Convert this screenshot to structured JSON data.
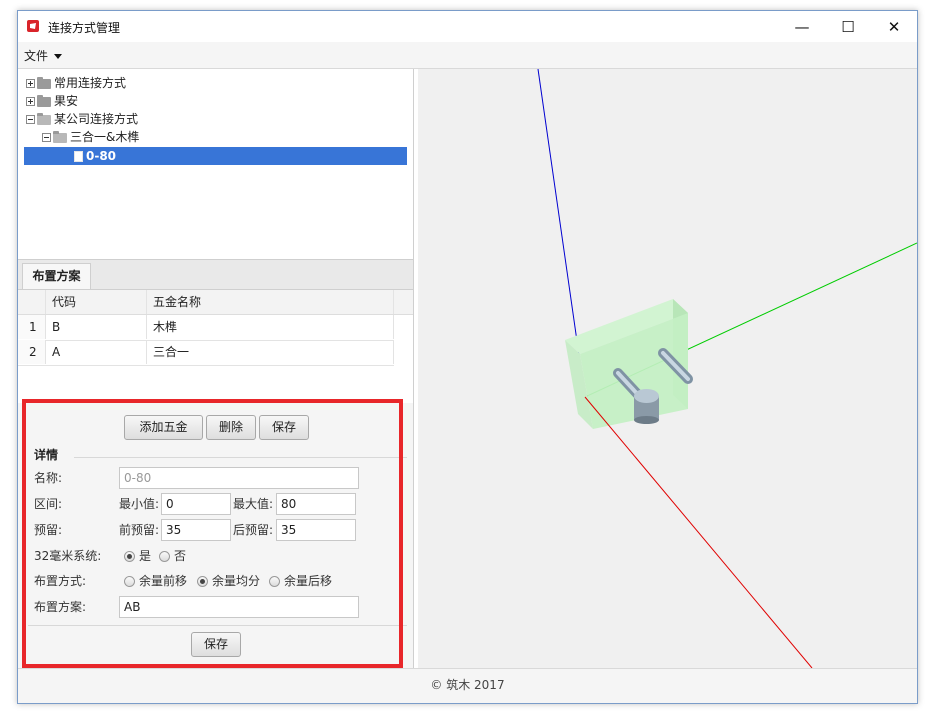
{
  "window": {
    "title": "连接方式管理",
    "controls": {
      "minimize": "—",
      "maximize": "☐",
      "close": "✕"
    }
  },
  "menu": {
    "file_label": "文件"
  },
  "tree": {
    "items": [
      {
        "label": "常用连接方式",
        "expanded": false
      },
      {
        "label": "果安",
        "expanded": false
      },
      {
        "label": "某公司连接方式",
        "expanded": true
      },
      {
        "label": "三合一&木榫",
        "expanded": true
      },
      {
        "label": "0-80",
        "selected": true
      }
    ]
  },
  "tabs": {
    "layout_tab": "布置方案"
  },
  "table": {
    "columns": [
      "代码",
      "五金名称"
    ],
    "rows": [
      {
        "index": "1",
        "code": "B",
        "name": "木榫"
      },
      {
        "index": "2",
        "code": "A",
        "name": "三合一"
      }
    ]
  },
  "buttons": {
    "add_hardware": "添加五金",
    "delete": "删除",
    "save_top": "保存",
    "save_bottom": "保存"
  },
  "details": {
    "heading": "详情",
    "name_label": "名称:",
    "name_value": "0-80",
    "range_label": "区间:",
    "min_label": "最小值:",
    "min_value": "0",
    "max_label": "最大值:",
    "max_value": "80",
    "reserve_label": "预留:",
    "front_label": "前预留:",
    "front_value": "35",
    "back_label": "后预留:",
    "back_value": "35",
    "system32_label": "32毫米系统:",
    "system32_options": [
      "是",
      "否"
    ],
    "system32_selected": "是",
    "layout_mode_label": "布置方式:",
    "layout_mode_options": [
      "余量前移",
      "余量均分",
      "余量后移"
    ],
    "layout_mode_selected": "余量均分",
    "layout_plan_label": "布置方案:",
    "layout_plan_value": "AB"
  },
  "footer": {
    "copyright": "© 筑木 2017"
  },
  "colors": {
    "selection": "#3875d7",
    "highlight_border": "#e8262a",
    "axis_x": "#e00000",
    "axis_y": "#0000d0",
    "axis_z": "#00cc00"
  }
}
